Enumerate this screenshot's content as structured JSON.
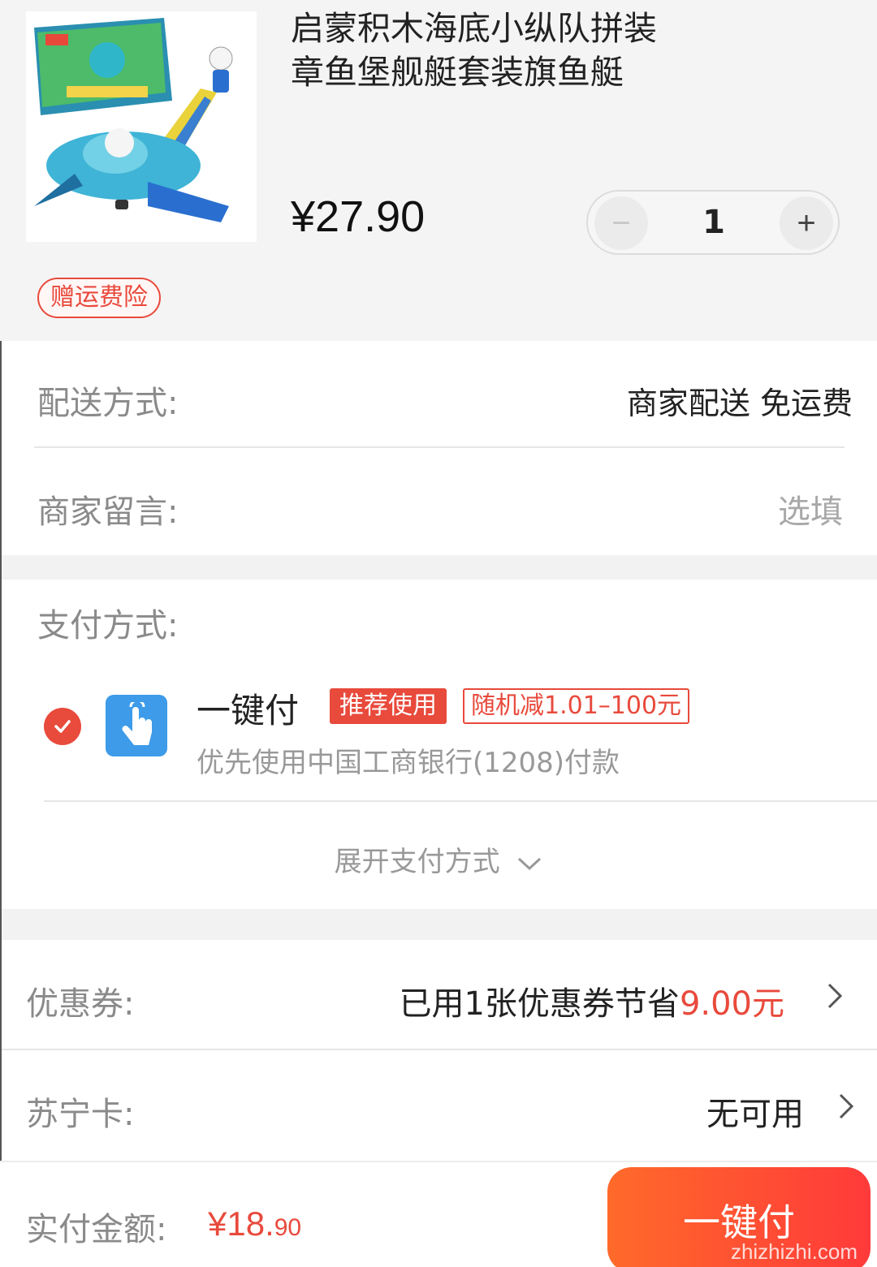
{
  "product": {
    "title_line1": "启蒙积木海底小纵队拼装",
    "title_line2": "章鱼堡舰艇套装旗鱼艇",
    "price": "¥27.90",
    "quantity": "1",
    "minus": "−",
    "plus": "+",
    "insurance_tag": "赠运费险"
  },
  "delivery": {
    "label": "配送方式:",
    "value": "商家配送 免运费"
  },
  "message": {
    "label": "商家留言:",
    "placeholder": "选填"
  },
  "payment": {
    "label": "支付方式:",
    "method_name": "一键付",
    "badge_recommend": "推荐使用",
    "badge_random": "随机减1.01–100元",
    "description": "优先使用中国工商银行(1208)付款",
    "expand_label": "展开支付方式"
  },
  "coupon": {
    "label": "优惠券:",
    "value_prefix": "已用1张优惠券节省",
    "value_amount": "9.00元"
  },
  "card": {
    "label": "苏宁卡:",
    "value": "无可用"
  },
  "footer": {
    "label": "实付金额:",
    "amount_big": "¥18.",
    "amount_small": "90",
    "submit_label": "一键付",
    "watermark": "zhizhizhi.com"
  },
  "colors": {
    "accent": "#e84a3c",
    "pay_icon": "#3d9be9"
  }
}
